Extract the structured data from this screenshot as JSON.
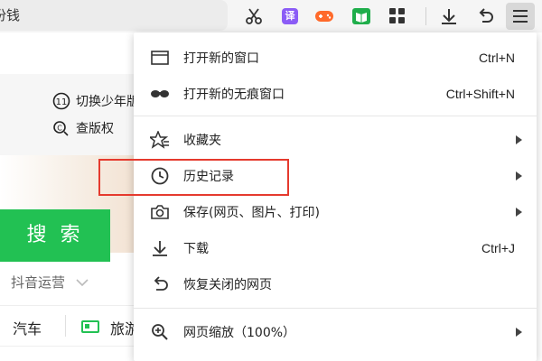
{
  "toolbar": {
    "address_text": "份钱",
    "translate_badge": "译",
    "icons": [
      "scissors-icon",
      "translate-icon",
      "game-icon",
      "reader-icon",
      "apps-grid-icon",
      "download-icon",
      "undo-icon",
      "menu-icon"
    ]
  },
  "page": {
    "top_links": [
      "切换少年版",
      "查版权"
    ],
    "search_button": "搜 索",
    "hot_label": "抖音运营",
    "nav": [
      "汽车",
      "旅游"
    ]
  },
  "menu": {
    "items": [
      {
        "label": "打开新的窗口",
        "shortcut": "Ctrl+N",
        "icon": "window-icon"
      },
      {
        "label": "打开新的无痕窗口",
        "shortcut": "Ctrl+Shift+N",
        "icon": "incognito-icon"
      },
      {
        "label": "收藏夹",
        "icon": "favorites-icon",
        "submenu": true
      },
      {
        "label": "历史记录",
        "icon": "history-clock-icon",
        "submenu": true
      },
      {
        "label": "保存(网页、图片、打印)",
        "icon": "camera-icon",
        "submenu": true
      },
      {
        "label": "下载",
        "shortcut": "Ctrl+J",
        "icon": "download-icon"
      },
      {
        "label": "恢复关闭的网页",
        "icon": "restore-icon"
      },
      {
        "label": "网页缩放（100%）",
        "icon": "zoom-icon",
        "submenu": true
      }
    ]
  },
  "colors": {
    "search_green": "#22c153",
    "highlight_red": "#e53a2e",
    "translate_purple": "#8b5cf6",
    "game_orange": "#ff6a2b",
    "reader_green": "#1fae4b"
  }
}
